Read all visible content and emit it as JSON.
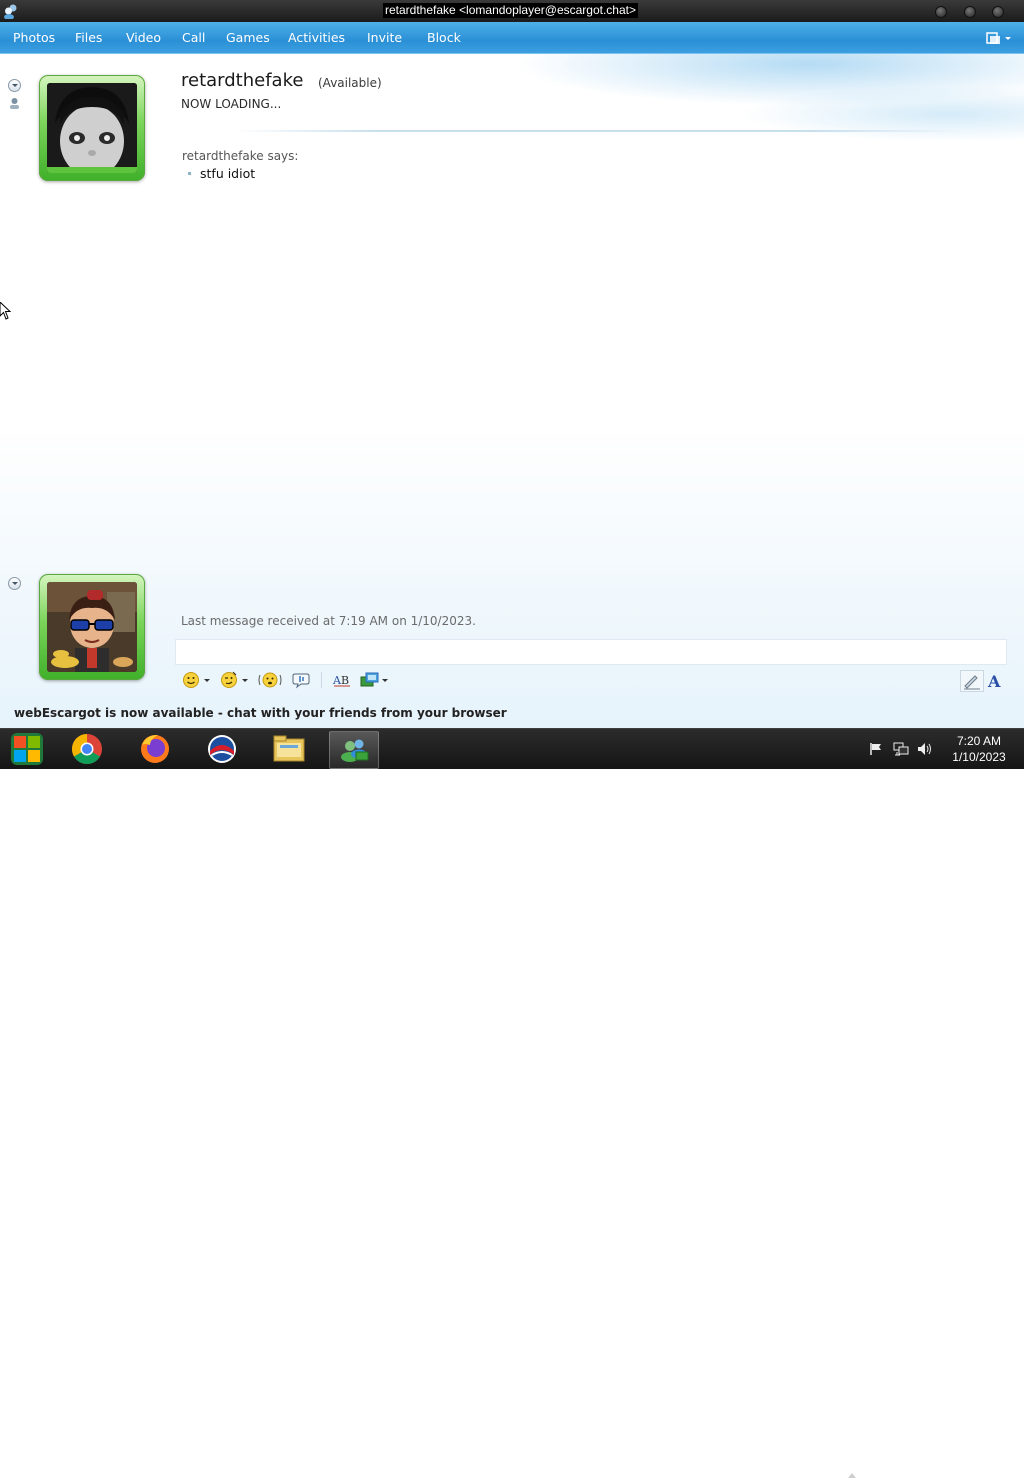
{
  "window": {
    "title": "retardthefake <lomandoplayer@escargot.chat>"
  },
  "menu": {
    "items": [
      "Photos",
      "Files",
      "Video",
      "Call",
      "Games",
      "Activities",
      "Invite",
      "Block"
    ]
  },
  "contact": {
    "name": "retardthefake",
    "status": "(Available)",
    "personal_message": "NOW LOADING..."
  },
  "conversation": {
    "messages": [
      {
        "sender_line": "retardthefake says:",
        "text": "stfu idiot"
      }
    ],
    "last_message": "Last message received at 7:19 AM on 1/10/2023."
  },
  "input": {
    "value": ""
  },
  "toolbar": {
    "icons": [
      "emoticon-icon",
      "wink-icon",
      "nudge-icon",
      "voice-clip-icon",
      "spellcheck-icon",
      "background-icon",
      "handwriting-icon",
      "font-icon"
    ],
    "font_glyph": "A"
  },
  "ad": {
    "text": "webEscargot is now available - chat with your friends from your browser"
  },
  "taskbar": {
    "apps": [
      "Start",
      "Google Chrome",
      "Firefox",
      "Windows Live Messenger",
      "File Explorer",
      "Messenger conversation"
    ],
    "time": "7:20 AM",
    "date": "1/10/2023"
  },
  "colors": {
    "menu_bar": "#2b8fd6",
    "avatar_frame": "#5dc43e",
    "taskbar": "#1e1e1e",
    "font_button": "#2a4fa5"
  }
}
